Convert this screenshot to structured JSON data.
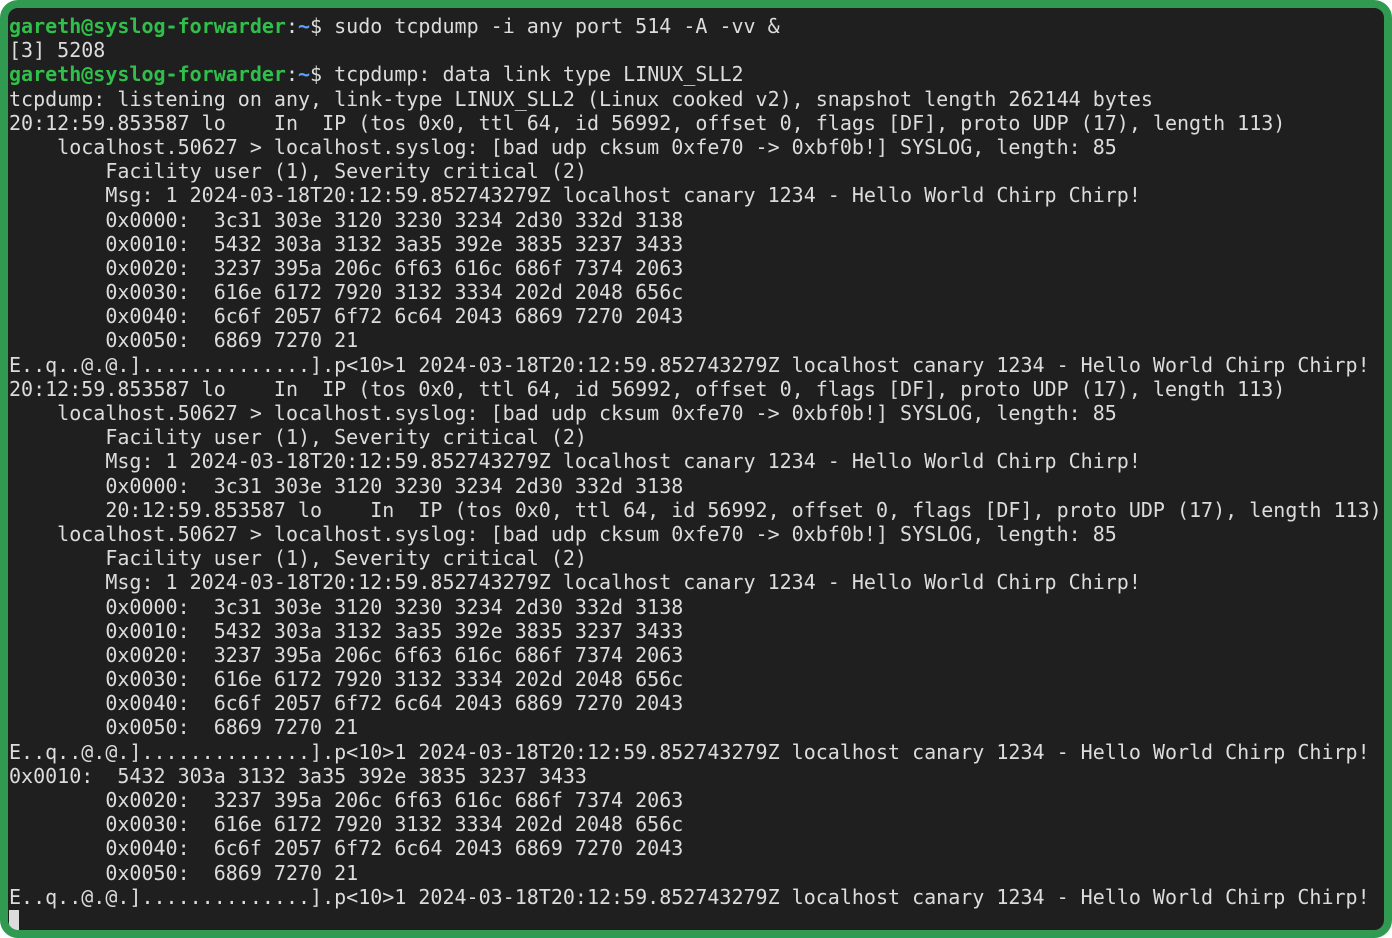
{
  "prompt": {
    "user_host": "gareth@syslog-forwarder",
    "path": "~",
    "symbol": "$"
  },
  "colors": {
    "frame": "#2f9a50",
    "background": "#1f1f1f",
    "text": "#dcdcdc",
    "user_host": "#2fbf4a",
    "path": "#5aa0ff"
  },
  "lines": [
    {
      "prompt": true,
      "text": " sudo tcpdump -i any port 514 -A -vv &"
    },
    {
      "text": "[3] 5208"
    },
    {
      "prompt": true,
      "text": " tcpdump: data link type LINUX_SLL2"
    },
    {
      "text": "tcpdump: listening on any, link-type LINUX_SLL2 (Linux cooked v2), snapshot length 262144 bytes"
    },
    {
      "text": "20:12:59.853587 lo    In  IP (tos 0x0, ttl 64, id 56992, offset 0, flags [DF], proto UDP (17), length 113)"
    },
    {
      "text": "    localhost.50627 > localhost.syslog: [bad udp cksum 0xfe70 -> 0xbf0b!] SYSLOG, length: 85"
    },
    {
      "text": "        Facility user (1), Severity critical (2)"
    },
    {
      "text": "        Msg: 1 2024-03-18T20:12:59.852743279Z localhost canary 1234 - Hello World Chirp Chirp!"
    },
    {
      "text": "        0x0000:  3c31 303e 3120 3230 3234 2d30 332d 3138"
    },
    {
      "text": "        0x0010:  5432 303a 3132 3a35 392e 3835 3237 3433"
    },
    {
      "text": "        0x0020:  3237 395a 206c 6f63 616c 686f 7374 2063"
    },
    {
      "text": "        0x0030:  616e 6172 7920 3132 3334 202d 2048 656c"
    },
    {
      "text": "        0x0040:  6c6f 2057 6f72 6c64 2043 6869 7270 2043"
    },
    {
      "text": "        0x0050:  6869 7270 21"
    },
    {
      "text": "E..q..@.@.]..............].p<10>1 2024-03-18T20:12:59.852743279Z localhost canary 1234 - Hello World Chirp Chirp!"
    },
    {
      "text": "20:12:59.853587 lo    In  IP (tos 0x0, ttl 64, id 56992, offset 0, flags [DF], proto UDP (17), length 113)"
    },
    {
      "text": "    localhost.50627 > localhost.syslog: [bad udp cksum 0xfe70 -> 0xbf0b!] SYSLOG, length: 85"
    },
    {
      "text": "        Facility user (1), Severity critical (2)"
    },
    {
      "text": "        Msg: 1 2024-03-18T20:12:59.852743279Z localhost canary 1234 - Hello World Chirp Chirp!"
    },
    {
      "text": "        0x0000:  3c31 303e 3120 3230 3234 2d30 332d 3138"
    },
    {
      "text": "        20:12:59.853587 lo    In  IP (tos 0x0, ttl 64, id 56992, offset 0, flags [DF], proto UDP (17), length 113)"
    },
    {
      "text": "    localhost.50627 > localhost.syslog: [bad udp cksum 0xfe70 -> 0xbf0b!] SYSLOG, length: 85"
    },
    {
      "text": "        Facility user (1), Severity critical (2)"
    },
    {
      "text": "        Msg: 1 2024-03-18T20:12:59.852743279Z localhost canary 1234 - Hello World Chirp Chirp!"
    },
    {
      "text": "        0x0000:  3c31 303e 3120 3230 3234 2d30 332d 3138"
    },
    {
      "text": "        0x0010:  5432 303a 3132 3a35 392e 3835 3237 3433"
    },
    {
      "text": "        0x0020:  3237 395a 206c 6f63 616c 686f 7374 2063"
    },
    {
      "text": "        0x0030:  616e 6172 7920 3132 3334 202d 2048 656c"
    },
    {
      "text": "        0x0040:  6c6f 2057 6f72 6c64 2043 6869 7270 2043"
    },
    {
      "text": "        0x0050:  6869 7270 21"
    },
    {
      "text": "E..q..@.@.]..............].p<10>1 2024-03-18T20:12:59.852743279Z localhost canary 1234 - Hello World Chirp Chirp!"
    },
    {
      "text": "0x0010:  5432 303a 3132 3a35 392e 3835 3237 3433"
    },
    {
      "text": "        0x0020:  3237 395a 206c 6f63 616c 686f 7374 2063"
    },
    {
      "text": "        0x0030:  616e 6172 7920 3132 3334 202d 2048 656c"
    },
    {
      "text": "        0x0040:  6c6f 2057 6f72 6c64 2043 6869 7270 2043"
    },
    {
      "text": "        0x0050:  6869 7270 21"
    },
    {
      "text": "E..q..@.@.]..............].p<10>1 2024-03-18T20:12:59.852743279Z localhost canary 1234 - Hello World Chirp Chirp!"
    }
  ]
}
